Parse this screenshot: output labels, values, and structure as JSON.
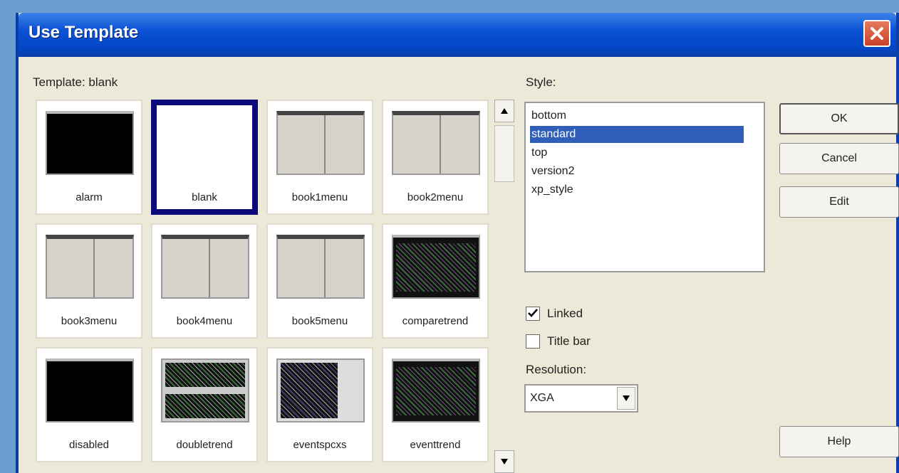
{
  "dialog": {
    "title": "Use Template",
    "template_label": "Template: blank",
    "style_label": "Style:",
    "resolution_label": "Resolution:"
  },
  "templates": [
    {
      "label": "alarm",
      "thumb": "black",
      "selected": false
    },
    {
      "label": "blank",
      "thumb": "white",
      "selected": true
    },
    {
      "label": "book1menu",
      "thumb": "book",
      "selected": false
    },
    {
      "label": "book2menu",
      "thumb": "book",
      "selected": false
    },
    {
      "label": "book3menu",
      "thumb": "book",
      "selected": false
    },
    {
      "label": "book4menu",
      "thumb": "book",
      "selected": false
    },
    {
      "label": "book5menu",
      "thumb": "book",
      "selected": false
    },
    {
      "label": "comparetrend",
      "thumb": "trend",
      "selected": false
    },
    {
      "label": "disabled",
      "thumb": "black",
      "selected": false
    },
    {
      "label": "doubletrend",
      "thumb": "double",
      "selected": false
    },
    {
      "label": "eventspcxs",
      "thumb": "events",
      "selected": false
    },
    {
      "label": "eventtrend",
      "thumb": "trend",
      "selected": false
    }
  ],
  "styles": [
    {
      "label": "bottom",
      "selected": false
    },
    {
      "label": "standard",
      "selected": true
    },
    {
      "label": "top",
      "selected": false
    },
    {
      "label": "version2",
      "selected": false
    },
    {
      "label": "xp_style",
      "selected": false
    }
  ],
  "buttons": {
    "ok": "OK",
    "cancel": "Cancel",
    "edit": "Edit",
    "help": "Help"
  },
  "options": {
    "linked_label": "Linked",
    "linked_checked": true,
    "titlebar_label": "Title bar",
    "titlebar_checked": false
  },
  "resolution": {
    "value": "XGA"
  },
  "colors": {
    "titlebar": "#0b52d6",
    "selection": "#2f5fb8",
    "selected_tile_border": "#0a0a7a"
  }
}
